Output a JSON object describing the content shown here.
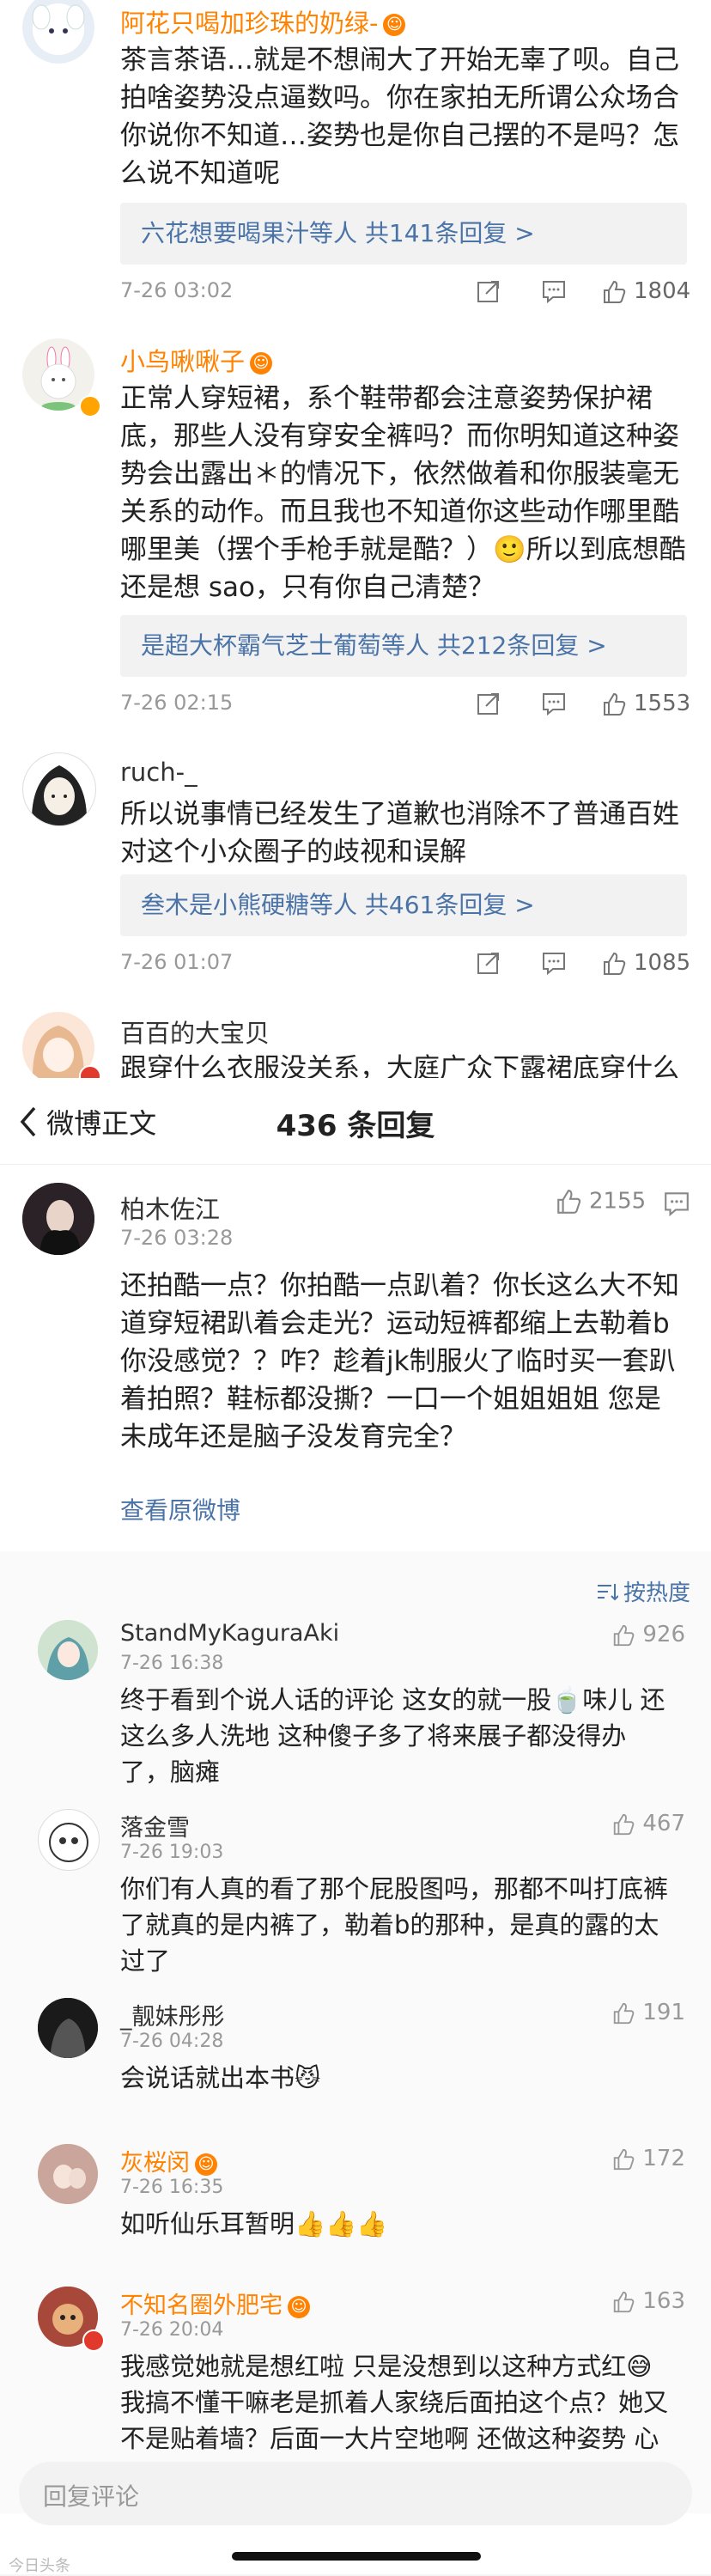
{
  "feed": {
    "comments": [
      {
        "name": "阿花只喝加珍珠的奶绿-",
        "text": "茶言茶语…就是不想闹大了开始无辜了呗。自己拍啥姿势没点逼数吗。你在家拍无所谓公众场合你说你不知道…姿势也是你自己摆的不是吗？怎么说不知道呢",
        "replies_user": "六花想要喝果汁等人",
        "replies_count": "共141条回复 >",
        "time": "7-26 03:02",
        "likes": "1804"
      },
      {
        "name": "小鸟啾啾子",
        "text": "正常人穿短裙，系个鞋带都会注意姿势保护裙底，那些人没有穿安全裤吗？而你明知道这种姿势会出露出＊的情况下，依然做着和你服装毫无关系的动作。而且我也不知道你这些动作哪里酷哪里美（摆个手枪手就是酷？）🙂所以到底想酷还是想 sao，只有你自己清楚？",
        "replies_user": "是超大杯霸气芝士葡萄等人",
        "replies_count": "共212条回复 >",
        "time": "7-26 02:15",
        "likes": "1553"
      },
      {
        "name": "ruch-_",
        "text": "所以说事情已经发生了道歉也消除不了普通百姓对这个小众圈子的歧视和误解",
        "replies_user": "叁木是小熊硬糖等人",
        "replies_count": "共461条回复 >",
        "time": "7-26 01:07",
        "likes": "1085"
      },
      {
        "name": "百百的大宝贝",
        "text": "跟穿什么衣服没关系，大庭广众下露裙底穿什么"
      }
    ]
  },
  "panel": {
    "back_label": "微博正文",
    "title": "436 条回复",
    "main": {
      "name": "柏木佐江",
      "time": "7-26 03:28",
      "likes": "2155",
      "text": "还拍酷一点？你拍酷一点趴着？你长这么大不知道穿短裙趴着会走光？运动短裤都缩上去勒着b你没感觉？？咋？趁着jk制服火了临时买一套趴着拍照？鞋标都没撕？一口一个姐姐姐姐 您是未成年还是脑子没发育完全？",
      "view_original": "查看原微博"
    },
    "sort_label": "按热度",
    "replies": [
      {
        "name": "StandMyKaguraAki",
        "time": "7-26 16:38",
        "likes": "926",
        "text": "终于看到个说人话的评论 这女的就一股🍵味儿 还这么多人洗地 这种傻子多了将来展子都没得办了，脑瘫"
      },
      {
        "name": "落金雪",
        "time": "7-26 19:03",
        "likes": "467",
        "text": "你们有人真的看了那个屁股图吗，那都不叫打底裤了就真的是内裤了，勒着b的那种，是真的露的太过了"
      },
      {
        "name": "_靓妹彤彤",
        "time": "7-26 04:28",
        "likes": "191",
        "text": "会说话就出本书😼"
      },
      {
        "name": "灰桜闵",
        "time": "7-26 16:35",
        "likes": "172",
        "text": "如听仙乐耳暂明👍👍👍"
      },
      {
        "name": "不知名圈外肥宅",
        "time": "7-26 20:04",
        "likes": "163",
        "text": "我感觉她就是想红啦 只是没想到以这种方式红😅我搞不懂干嘛老是抓着人家绕后面拍这个点？她又不是贴着墙？后面一大片空地啊 还做这种姿势 心里"
      }
    ],
    "input_placeholder": "回复评论",
    "watermark": "今日头条"
  },
  "colors": {
    "accent": "#ff8200",
    "link": "#4a73a8",
    "muted": "#999999"
  }
}
